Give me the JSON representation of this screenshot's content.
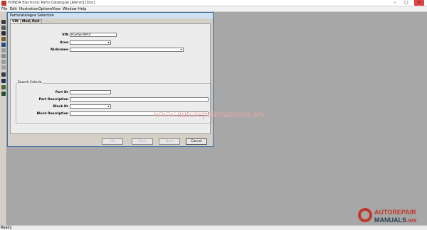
{
  "window": {
    "title": "HONDA Electronic Parts Catalogue   [Admin]   [Doc]"
  },
  "menu": [
    "File",
    "Edit",
    "Illustration",
    "Options",
    "View",
    "Window",
    "Help"
  ],
  "dialog": {
    "title": "Partscatalogue Selection",
    "tabs": [
      "VIN",
      "Model",
      "Part"
    ],
    "fields": {
      "vin": {
        "label": "VIN",
        "value": "PLEASE INPUT"
      },
      "area": {
        "label": "Area",
        "value": ""
      },
      "nickname": {
        "label": "Nickname",
        "value": ""
      }
    },
    "search_criteria": {
      "title": "Search Criteria",
      "part_nr": {
        "label": "Part Nr",
        "value": ""
      },
      "part_description": {
        "label": "Part Description",
        "value": ""
      },
      "block_nr": {
        "label": "Block Nr",
        "value": ""
      },
      "block_description": {
        "label": "Block Description",
        "value": ""
      }
    },
    "buttons": {
      "ok": "OK",
      "back": "Back",
      "next": "Next",
      "cancel": "Cancel"
    }
  },
  "watermark": "www.autorepairmanuals.ws",
  "logo": {
    "line1": "AUTOREPAIR",
    "line2a": "MANUALS",
    "line2b": ".ws"
  },
  "status": {
    "text": "Ready"
  },
  "colors": {
    "desktop": "#a7a7a7",
    "accent": "#c0392b",
    "dialog_border": "#3a6ea5"
  }
}
